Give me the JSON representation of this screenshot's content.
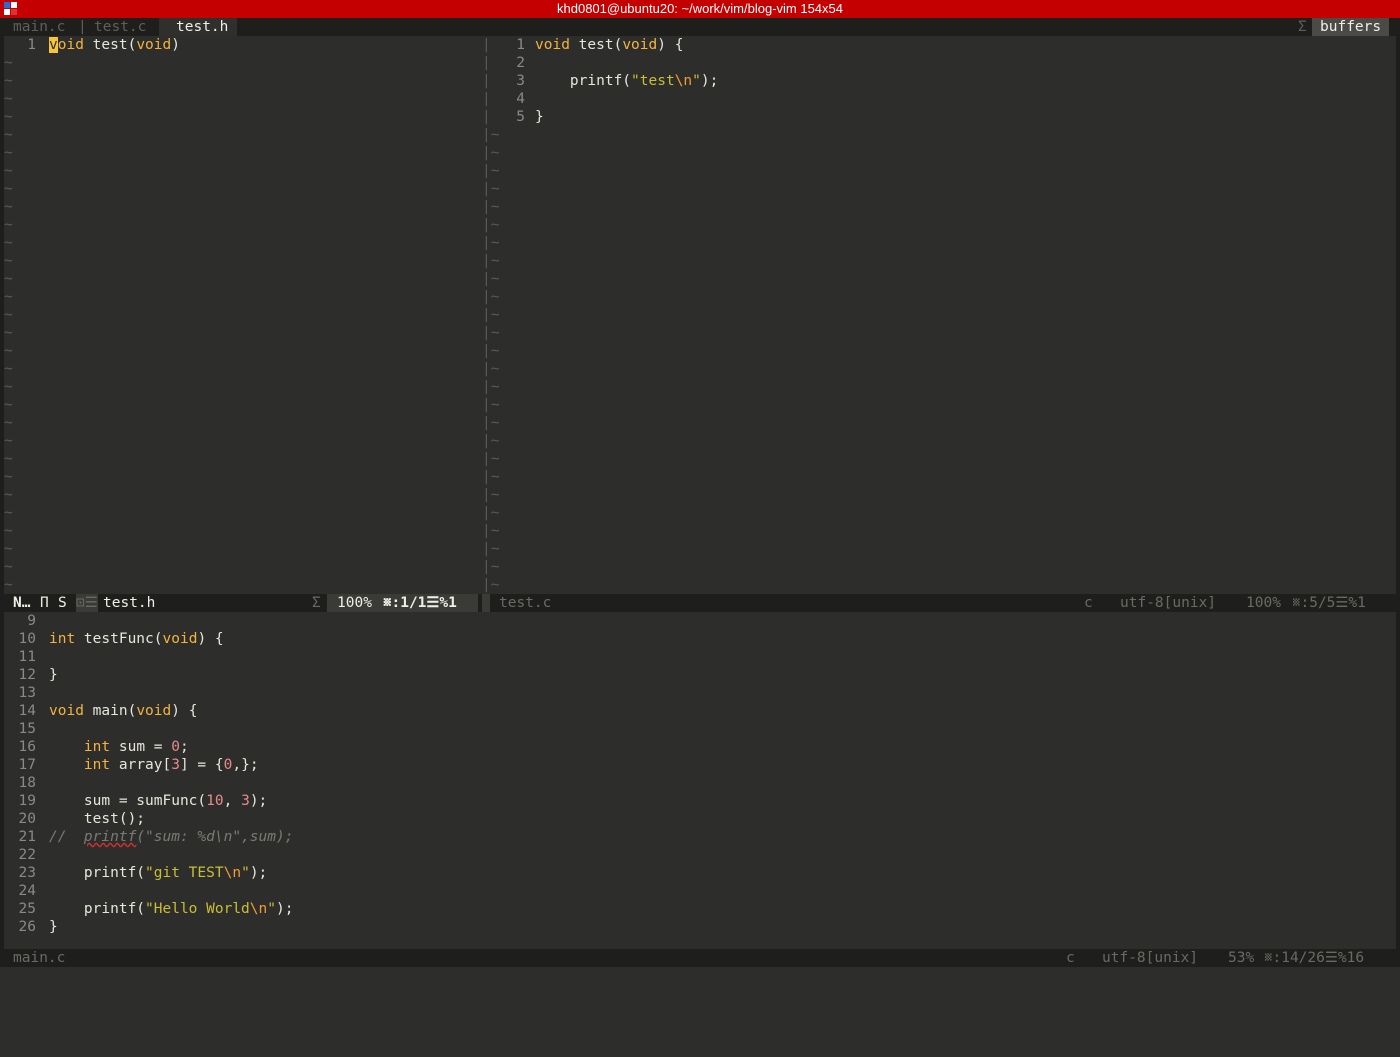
{
  "window": {
    "title": "khd0801@ubuntu20: ~/work/vim/blog-vim 154x54",
    "icon": "terminal-app-icon",
    "accent": "#c40000"
  },
  "tabline": {
    "tabs": [
      {
        "label": "main.c",
        "active": false
      },
      {
        "label": "test.c",
        "active": false
      },
      {
        "label": "test.h",
        "active": true
      }
    ],
    "separator": "|",
    "buffers_sigma": "Σ",
    "buffers_label": "buffers"
  },
  "left_pane": {
    "lines": [
      {
        "num": "1",
        "parts": [
          {
            "t": "v",
            "c": "cursor"
          },
          {
            "t": "oid",
            "c": "kw"
          },
          {
            "t": " test(",
            "c": "fn"
          },
          {
            "t": "void",
            "c": "kw"
          },
          {
            "t": ")",
            "c": "fn"
          }
        ]
      }
    ],
    "tilde": "~"
  },
  "right_pane": {
    "lines": [
      {
        "num": "1",
        "parts": [
          {
            "t": "void",
            "c": "kw"
          },
          {
            "t": " test(",
            "c": "fn"
          },
          {
            "t": "void",
            "c": "kw"
          },
          {
            "t": ") {",
            "c": "fn"
          }
        ]
      },
      {
        "num": "2",
        "parts": []
      },
      {
        "num": "3",
        "parts": [
          {
            "t": "    printf(",
            "c": "fn"
          },
          {
            "t": "\"test",
            "c": "str"
          },
          {
            "t": "\\n",
            "c": "esc"
          },
          {
            "t": "\"",
            "c": "str"
          },
          {
            "t": ");",
            "c": "fn"
          }
        ]
      },
      {
        "num": "4",
        "parts": []
      },
      {
        "num": "5",
        "parts": [
          {
            "t": "}",
            "c": "fn"
          }
        ]
      }
    ],
    "split_char": "|",
    "split_tilde": "|~"
  },
  "status_left": {
    "mode": "N…",
    "git_icon": "Π",
    "session_flag": "S",
    "file_icon": "⊡☰",
    "filename": "test.h",
    "sigma": "Σ",
    "percent": "100%",
    "position": "␧:1/1☰%1"
  },
  "status_right": {
    "filename": "test.c",
    "filetype": "c",
    "encoding": "utf-8[unix]",
    "percent": "100%",
    "position": "␧:5/5☰%1"
  },
  "bottom_pane": {
    "lines": [
      {
        "num": "9",
        "parts": []
      },
      {
        "num": "10",
        "parts": [
          {
            "t": "int",
            "c": "kw"
          },
          {
            "t": " testFunc(",
            "c": "fn"
          },
          {
            "t": "void",
            "c": "kw"
          },
          {
            "t": ") {",
            "c": "fn"
          }
        ]
      },
      {
        "num": "11",
        "parts": []
      },
      {
        "num": "12",
        "parts": [
          {
            "t": "}",
            "c": "fn"
          }
        ]
      },
      {
        "num": "13",
        "parts": []
      },
      {
        "num": "14",
        "parts": [
          {
            "t": "void",
            "c": "kw"
          },
          {
            "t": " main(",
            "c": "fn"
          },
          {
            "t": "void",
            "c": "kw"
          },
          {
            "t": ") {",
            "c": "fn"
          }
        ]
      },
      {
        "num": "15",
        "parts": []
      },
      {
        "num": "16",
        "parts": [
          {
            "t": "    ",
            "c": "fn"
          },
          {
            "t": "int",
            "c": "kw"
          },
          {
            "t": " sum = ",
            "c": "fn"
          },
          {
            "t": "0",
            "c": "num"
          },
          {
            "t": ";",
            "c": "fn"
          }
        ]
      },
      {
        "num": "17",
        "parts": [
          {
            "t": "    ",
            "c": "fn"
          },
          {
            "t": "int",
            "c": "kw"
          },
          {
            "t": " array[",
            "c": "fn"
          },
          {
            "t": "3",
            "c": "num"
          },
          {
            "t": "] = {",
            "c": "fn"
          },
          {
            "t": "0",
            "c": "num"
          },
          {
            "t": ",};",
            "c": "fn"
          }
        ]
      },
      {
        "num": "18",
        "parts": []
      },
      {
        "num": "19",
        "parts": [
          {
            "t": "    sum = sumFunc(",
            "c": "fn"
          },
          {
            "t": "10",
            "c": "num"
          },
          {
            "t": ", ",
            "c": "fn"
          },
          {
            "t": "3",
            "c": "num"
          },
          {
            "t": ");",
            "c": "fn"
          }
        ]
      },
      {
        "num": "20",
        "parts": [
          {
            "t": "    test();",
            "c": "fn"
          }
        ]
      },
      {
        "num": "21",
        "parts": [
          {
            "t": "//  ",
            "c": "cmt"
          },
          {
            "t": "printf",
            "c": "cmt spell"
          },
          {
            "t": "(\"sum: %d\\n\",sum);",
            "c": "cmt"
          }
        ]
      },
      {
        "num": "22",
        "parts": []
      },
      {
        "num": "23",
        "parts": [
          {
            "t": "    printf(",
            "c": "fn"
          },
          {
            "t": "\"git TEST",
            "c": "str"
          },
          {
            "t": "\\n",
            "c": "esc"
          },
          {
            "t": "\"",
            "c": "str"
          },
          {
            "t": ");",
            "c": "fn"
          }
        ]
      },
      {
        "num": "24",
        "parts": []
      },
      {
        "num": "25",
        "parts": [
          {
            "t": "    printf(",
            "c": "fn"
          },
          {
            "t": "\"Hello World",
            "c": "str"
          },
          {
            "t": "\\n",
            "c": "esc"
          },
          {
            "t": "\"",
            "c": "str"
          },
          {
            "t": ");",
            "c": "fn"
          }
        ]
      },
      {
        "num": "26",
        "parts": [
          {
            "t": "}",
            "c": "fn"
          }
        ]
      }
    ]
  },
  "status_bottom": {
    "filename": "main.c",
    "filetype": "c",
    "encoding": "utf-8[unix]",
    "percent": "53%",
    "position": "␧:14/26☰%16"
  }
}
